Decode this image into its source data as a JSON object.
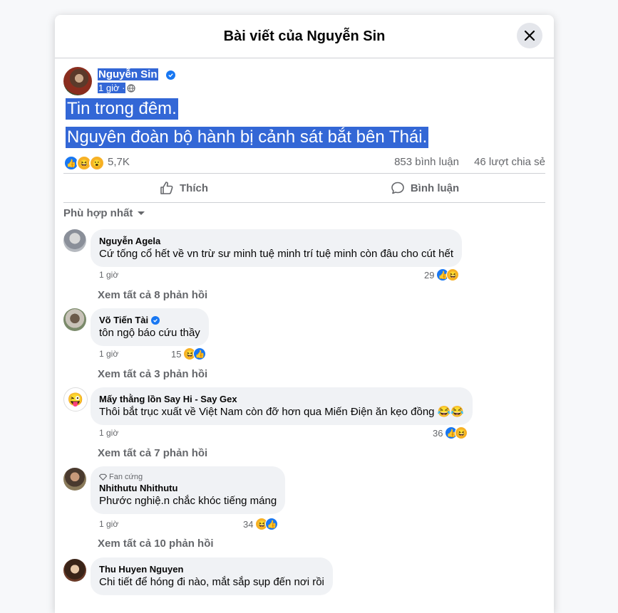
{
  "modal": {
    "title": "Bài viết của Nguyễn Sin"
  },
  "post": {
    "author": "Nguyễn Sin",
    "time": "1 giờ ·",
    "lines": [
      "Tin trong đêm.",
      "Nguyên đoàn bộ hành bị cảnh sát bắt bên Thái."
    ],
    "reaction_count": "5,7K",
    "comment_count": "853 bình luận",
    "share_count": "46 lượt chia sẻ"
  },
  "actions": {
    "like": "Thích",
    "comment": "Bình luận"
  },
  "sort": {
    "label": "Phù hợp nhất"
  },
  "comments": [
    {
      "name": "Nguyễn Agela",
      "text": "Cứ tống cổ hết về vn trừ sư minh tuệ minh trí tuệ minh còn đâu cho cút hết",
      "time": "1 giờ",
      "reacts": "29",
      "replies": "Xem tất cả 8 phản hồi"
    },
    {
      "name": "Võ Tiến Tài",
      "text": "tôn ngộ báo cứu thầy",
      "time": "1 giờ",
      "reacts": "15",
      "replies": "Xem tất cả 3 phản hồi"
    },
    {
      "name": "Mấy thằng lồn Say Hi - Say Gex",
      "text": "Thôi bắt trục xuất về Việt Nam còn đỡ hơn qua Miến Điện ăn kẹo đồng 😂😂",
      "time": "1 giờ",
      "reacts": "36",
      "replies": "Xem tất cả 7 phản hồi"
    },
    {
      "badge": "Fan cứng",
      "name": "Nhithutu Nhithutu",
      "text": "Phước nghiệ.n chắc khóc tiếng máng",
      "time": "1 giờ",
      "reacts": "34",
      "replies": "Xem tất cả 10 phản hồi"
    },
    {
      "name": "Thu Huyen Nguyen",
      "text": "Chi tiết để hóng đi nào, mắt sắp sụp đến nơi rồi"
    }
  ],
  "colors": {
    "accent": "#1877f2",
    "selection": "#3367d6",
    "bubble": "#f0f2f5",
    "secondary_text": "#65676b"
  },
  "icons": [
    "close-icon",
    "verified-icon",
    "globe-icon",
    "thumbs-up-icon",
    "comment-icon",
    "chevron-down-icon",
    "like-reaction-icon",
    "haha-reaction-icon",
    "wow-reaction-icon",
    "diamond-icon"
  ]
}
